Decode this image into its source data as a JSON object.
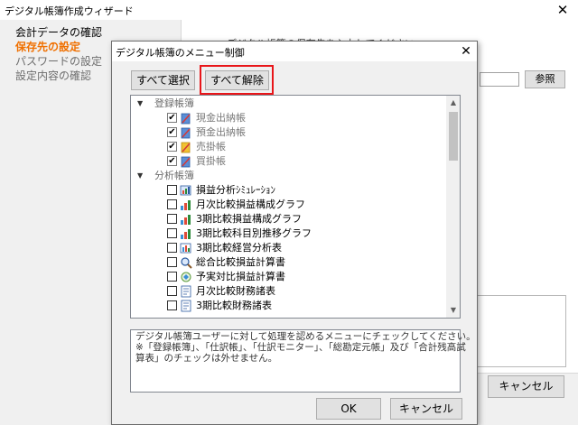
{
  "wizard": {
    "title": "デジタル帳簿作成ウィザード",
    "close_glyph": "✕",
    "nav": [
      {
        "label": "会計データの確認"
      },
      {
        "label": "保存先の設定"
      },
      {
        "label": "パスワードの設定"
      },
      {
        "label": "設定内容の確認"
      }
    ],
    "instruction": "デジタル帳簿の保存先を入力してください",
    "browse_label": "参照",
    "cancel_label": "キャンセル"
  },
  "dialog": {
    "title": "デジタル帳簿のメニュー制御",
    "close_glyph": "✕",
    "select_all_label": "すべて選択",
    "deselect_all_label": "すべて解除",
    "highlight_color": "#e8161a",
    "groups": [
      {
        "label": "登録帳簿",
        "items": [
          {
            "label": "現金出納帳",
            "checked": true,
            "disabled": true,
            "icon": "ledger-blue-icon"
          },
          {
            "label": "預金出納帳",
            "checked": true,
            "disabled": true,
            "icon": "ledger-blue-icon"
          },
          {
            "label": "売掛帳",
            "checked": true,
            "disabled": true,
            "icon": "ledger-yellow-icon"
          },
          {
            "label": "買掛帳",
            "checked": true,
            "disabled": true,
            "icon": "ledger-blue-icon"
          }
        ]
      },
      {
        "label": "分析帳簿",
        "items": [
          {
            "label": "損益分析ｼﾐｭﾚｰｼｮﾝ",
            "checked": false,
            "disabled": false,
            "icon": "simulation-icon"
          },
          {
            "label": "月次比較損益構成グラフ",
            "checked": false,
            "disabled": false,
            "icon": "bar-chart-icon"
          },
          {
            "label": "3期比較損益構成グラフ",
            "checked": false,
            "disabled": false,
            "icon": "bar-chart-icon"
          },
          {
            "label": "3期比較科目別推移グラフ",
            "checked": false,
            "disabled": false,
            "icon": "bar-chart-icon"
          },
          {
            "label": "3期比較経営分析表",
            "checked": false,
            "disabled": false,
            "icon": "analysis-icon"
          },
          {
            "label": "総合比較損益計算書",
            "checked": false,
            "disabled": false,
            "icon": "magnifier-icon"
          },
          {
            "label": "予実対比損益計算書",
            "checked": false,
            "disabled": false,
            "icon": "compare-icon"
          },
          {
            "label": "月次比較財務諸表",
            "checked": false,
            "disabled": false,
            "icon": "report-icon"
          },
          {
            "label": "3期比較財務諸表",
            "checked": false,
            "disabled": false,
            "icon": "report-icon"
          }
        ]
      }
    ],
    "message_lines": [
      "デジタル帳簿ユーザーに対して処理を認めるメニューにチェックしてください。",
      "※「登録帳簿」、「仕訳帳」、「仕訳モニター」、「総勘定元帳」及び「合計残高試",
      "算表」のチェックは外せません。"
    ],
    "ok_label": "OK",
    "cancel_label": "キャンセル"
  }
}
